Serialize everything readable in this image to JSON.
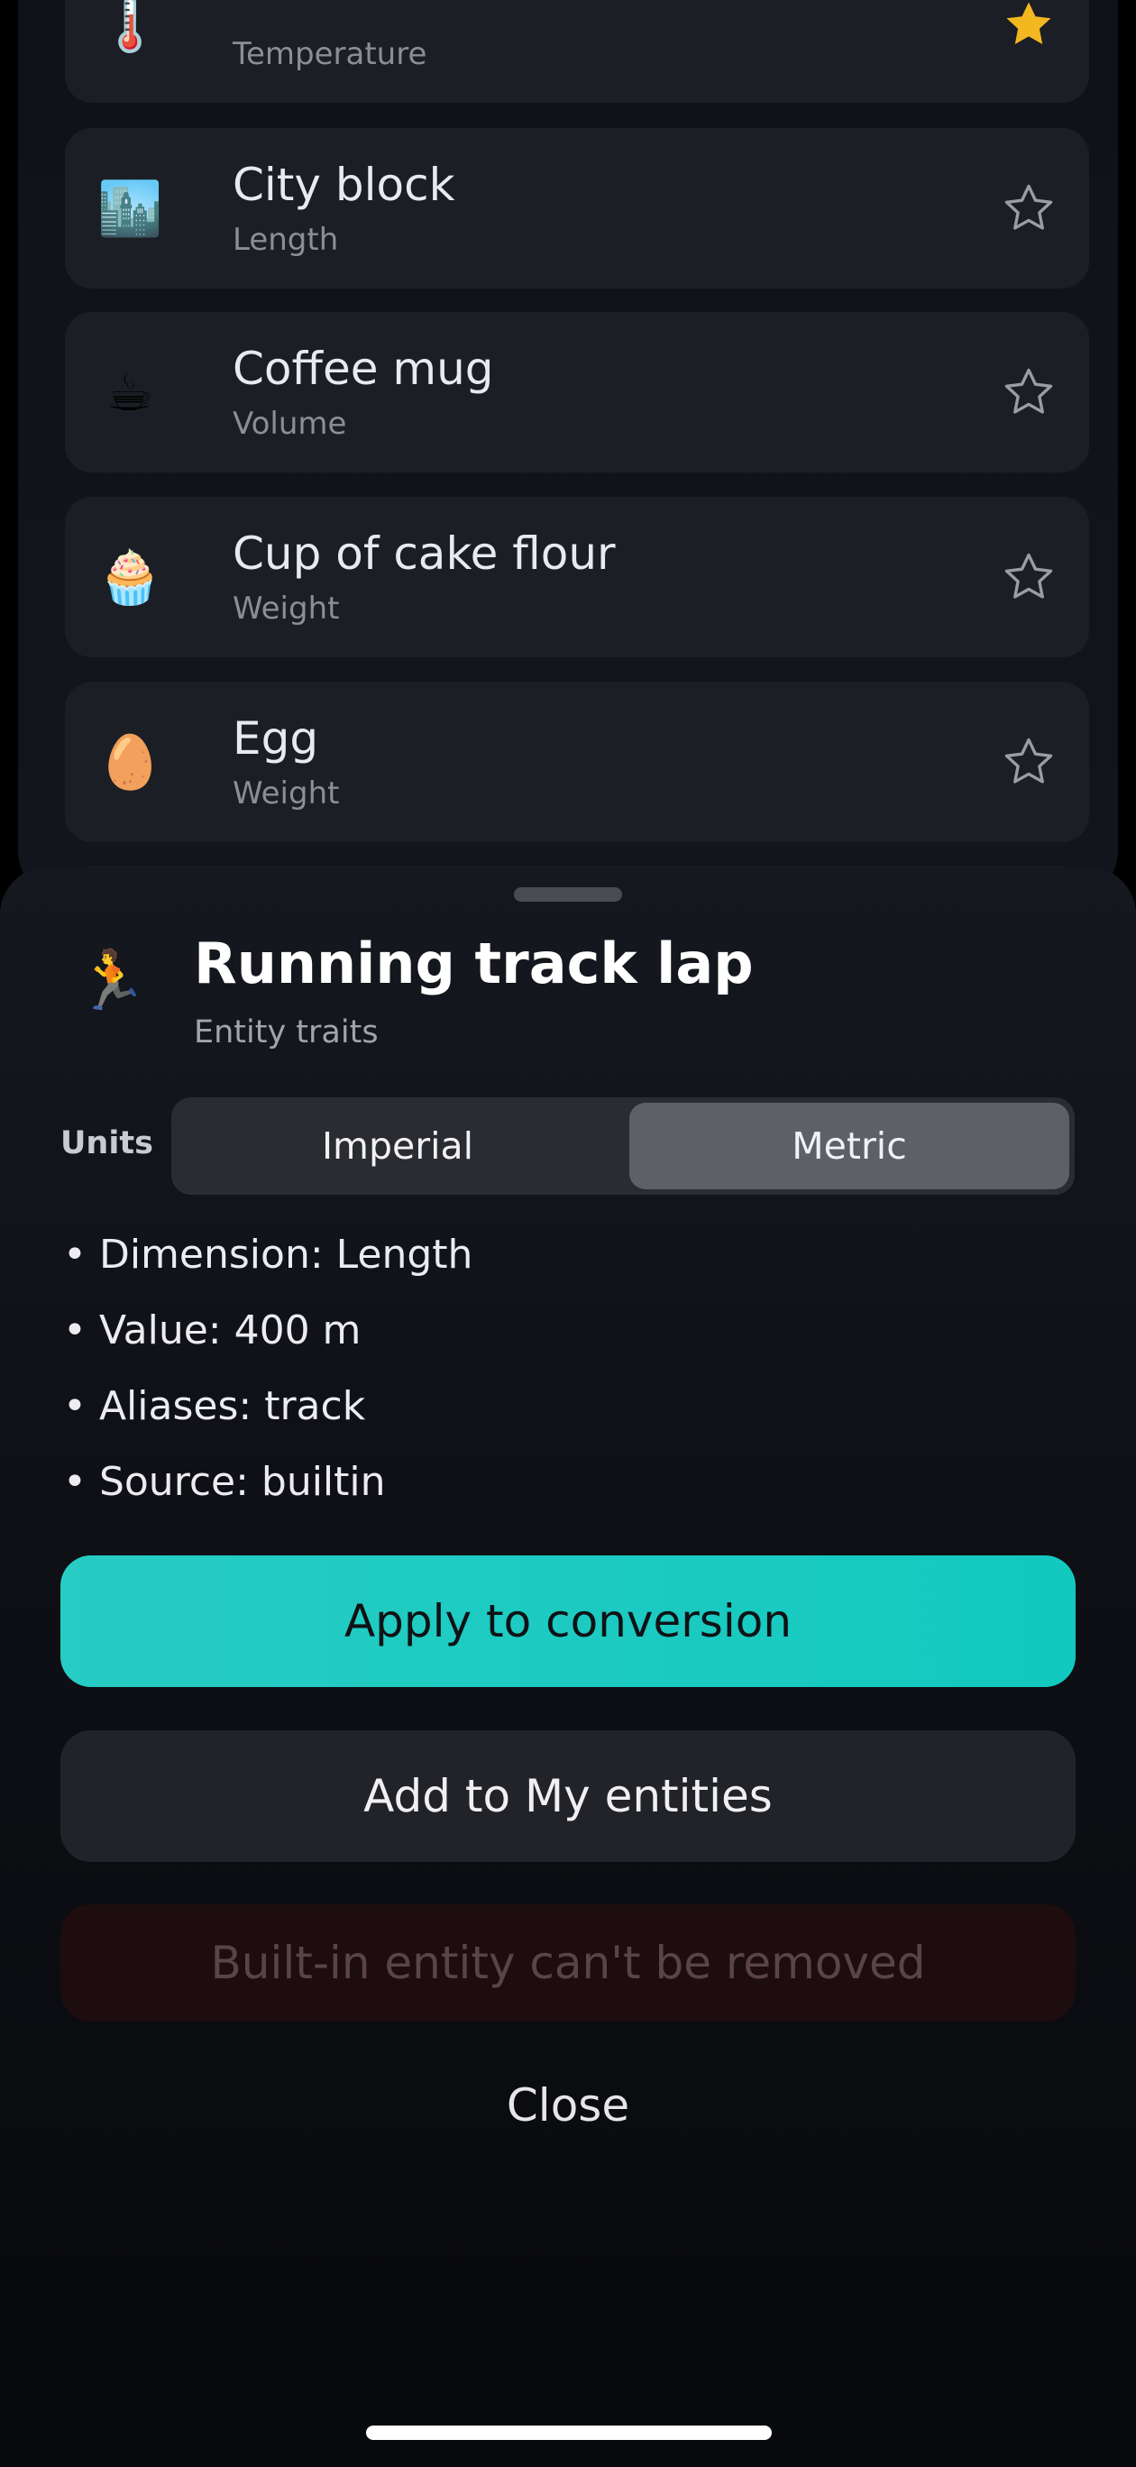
{
  "list": {
    "rows": [
      {
        "icon": "thermometer-icon",
        "glyph": "🌡️",
        "title": "",
        "subtitle": "Temperature",
        "favorite": true
      },
      {
        "icon": "city-icon",
        "glyph": "🏙️",
        "title": "City block",
        "subtitle": "Length",
        "favorite": false
      },
      {
        "icon": "coffee-icon",
        "glyph": "☕",
        "title": "Coffee mug",
        "subtitle": "Volume",
        "favorite": false
      },
      {
        "icon": "cupcake-icon",
        "glyph": "🧁",
        "title": "Cup of cake flour",
        "subtitle": "Weight",
        "favorite": false
      },
      {
        "icon": "egg-icon",
        "glyph": "🥚",
        "title": "Egg",
        "subtitle": "Weight",
        "favorite": false
      }
    ]
  },
  "sheet": {
    "icon": "runner-icon",
    "glyph": "🏃",
    "title": "Running track lap",
    "subtitle": "Entity traits",
    "units_label": "Units",
    "units_options": [
      "Imperial",
      "Metric"
    ],
    "units_selected": "Metric",
    "traits": [
      "Dimension: Length",
      "Value: 400 m",
      "Aliases: track",
      "Source: builtin"
    ],
    "bullet": "•",
    "apply_label": "Apply to conversion",
    "add_label": "Add to My entities",
    "remove_label": "Built-in entity can't be removed",
    "close_label": "Close"
  },
  "colors": {
    "accent": "#1ecac1",
    "favorite_star": "#f3b81f",
    "star_outline": "#9b9da3"
  }
}
